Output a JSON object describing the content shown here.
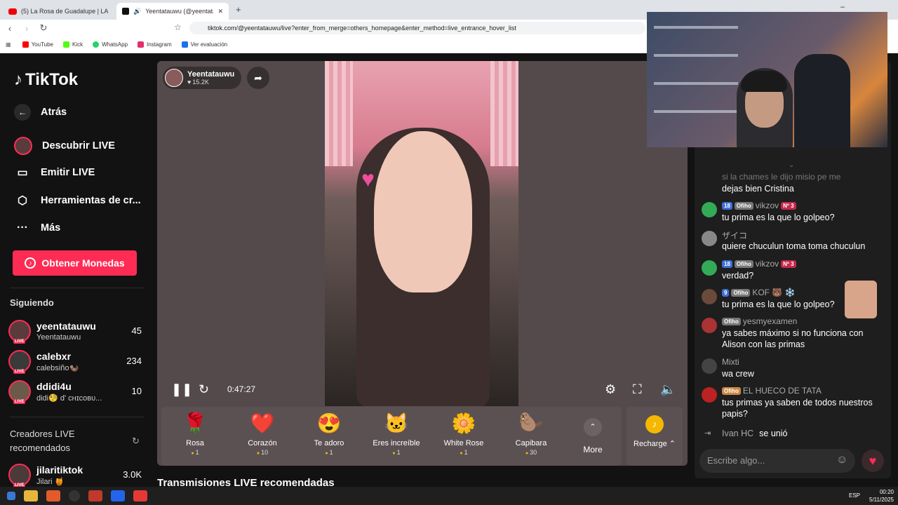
{
  "browser": {
    "tabs": [
      {
        "title": "(5) La Rosa de Guadalupe | LA SANGR"
      },
      {
        "title": "Yeentatauwu (@yeentatauwu"
      }
    ],
    "new_tab": "+",
    "url": "tiktok.com/@yeentatauwu/live?enter_from_merge=others_homepage&enter_method=live_entrance_hover_list",
    "bookmarks": [
      "YouTube",
      "Kick",
      "WhatsApp",
      "Instagram",
      "Ver evaluación"
    ],
    "bookmark_colors": [
      "#ff0000",
      "#53fc18",
      "#25d366",
      "#e1306c",
      "#1a73e8"
    ]
  },
  "sidebar": {
    "logo": "TikTok",
    "back": "Atrás",
    "nav": [
      "Descubrir LIVE",
      "Emitir LIVE",
      "Herramientas de cr...",
      "Más"
    ],
    "coins_button": "Obtener Monedas",
    "following_title": "Siguiendo",
    "following": [
      {
        "name": "yeentatauwu",
        "sub": "Yeentatauwu",
        "count": "45"
      },
      {
        "name": "calebxr",
        "sub": "calebsiño🦦",
        "count": "234"
      },
      {
        "name": "ddidi4u",
        "sub": "didi🧐 d' ᴄʜɪᴄᴏʙᴜ...",
        "count": "10"
      }
    ],
    "creators_title_1": "Creadores LIVE",
    "creators_title_2": "recomendados",
    "creators": [
      {
        "name": "jilaritiktok",
        "sub": "Jilari 🍯",
        "count": "3.0K"
      }
    ]
  },
  "player": {
    "host_name": "Yeentatauwu",
    "host_likes": "15.2K",
    "time": "0:47:27"
  },
  "gifts": [
    {
      "name": "Rosa",
      "price": "1",
      "icon": "🌹"
    },
    {
      "name": "Corazón",
      "price": "10",
      "icon": "❤️"
    },
    {
      "name": "Te adoro",
      "price": "1",
      "icon": "😍"
    },
    {
      "name": "Eres increíble",
      "price": "1",
      "icon": "🐱"
    },
    {
      "name": "White Rose",
      "price": "1",
      "icon": "🌼"
    },
    {
      "name": "Capibara",
      "price": "30",
      "icon": "🦫"
    }
  ],
  "more_label": "More",
  "recharge_label": "Recharge",
  "recommended_title": "Transmisiones LIVE recomendadas",
  "chat": {
    "partial_top": "si la chames le dijo misio pe me",
    "messages": [
      {
        "user": "",
        "text": "dejas bien Cristina"
      },
      {
        "user": "vikzov",
        "level": "18",
        "fan": "Ofiho",
        "rank": "Nº 3",
        "text": "tu prima es la que lo golpeo?"
      },
      {
        "user": "ザイコ",
        "text": "quiere chuculun toma toma chuculun"
      },
      {
        "user": "vikzov",
        "level": "18",
        "fan": "Ofiho",
        "rank": "Nº 3",
        "text": "verdad?"
      },
      {
        "user": "KOF 🐻 ❄️",
        "level": "9",
        "fan": "Ofiho",
        "text": "tu prima es la que lo golpeo?"
      },
      {
        "user": "yesmyexamen",
        "fan": "Ofiho",
        "text": "ya sabes máximo si no funciona con Alison con las primas"
      },
      {
        "user": "Mixti",
        "text": "wa crew"
      },
      {
        "user": "EL HUECO DE TATA",
        "fan": "Ofiho",
        "text": "tus primas ya saben de todos nuestros papis?"
      }
    ],
    "join_user": "Ivan HC",
    "join_text": "se unió",
    "input_placeholder": "Escribe algo..."
  },
  "taskbar": {
    "time": "00:20",
    "date": "5/11/2025",
    "lang": "ESP"
  }
}
